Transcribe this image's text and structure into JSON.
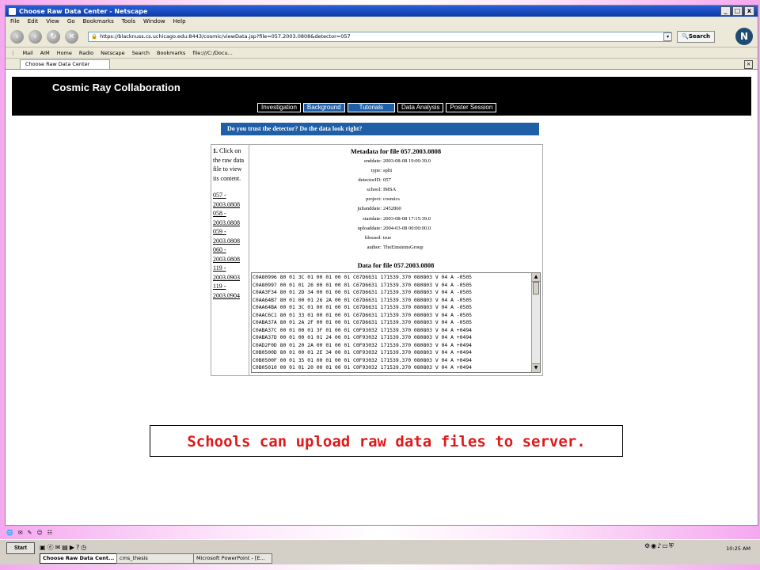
{
  "window": {
    "title": "Choose Raw Data Center - Netscape",
    "controls": [
      "_",
      "□",
      "x"
    ]
  },
  "menu": [
    "File",
    "Edit",
    "View",
    "Go",
    "Bookmarks",
    "Tools",
    "Window",
    "Help"
  ],
  "nav": {
    "url": "https://blacknuss.cs.uchicago.edu:8443/cosmic/viewData.jsp?file=057.2003.0808&detector=057",
    "search_label": "Search",
    "logo": "N"
  },
  "personal_bar": [
    "Mail",
    "AIM",
    "Home",
    "Radio",
    "Netscape",
    "Search",
    "Bookmarks",
    "file:///C:/Docu..."
  ],
  "tab": {
    "label": "Choose Raw Data Center"
  },
  "page": {
    "brand": "Cosmic Ray Collaboration",
    "topnav": [
      "Investigation",
      "Background",
      "Tutorials",
      "Data Analysis",
      "Poster Session"
    ],
    "question": "Do you trust the detector? Do the data look right?",
    "instruction_num": "1.",
    "instruction": "Click on the raw data file to view its content.",
    "files": [
      "057 - 2003.0808",
      "058 - 2003.0808",
      "059 - 2003.0808",
      "060 - 2003.0808",
      "119 - 2003.0903",
      "119 - 2003.0904"
    ],
    "metadata_title": "Metadata for file 057.2003.0808",
    "metadata": [
      {
        "k": "enddate:",
        "v": "2003-08-08 19:00:39.0"
      },
      {
        "k": "type:",
        "v": "split"
      },
      {
        "k": "detectorID:",
        "v": "057"
      },
      {
        "k": "school:",
        "v": "IMSA"
      },
      {
        "k": "project:",
        "v": "cosmics"
      },
      {
        "k": "julianddate:",
        "v": "2452860"
      },
      {
        "k": "startdate:",
        "v": "2003-08-08 17:15:39.0"
      },
      {
        "k": "uploaddate:",
        "v": "2004-03-08 00:00:00.0"
      },
      {
        "k": "blessed:",
        "v": "true"
      },
      {
        "k": "author:",
        "v": "TheEinsteinsGroup"
      }
    ],
    "data_title": "Data for file 057.2003.0808",
    "data_rows": [
      "C0A80996 80 01 3C 01 00 01 00 01 C67D6631 171539.370 080803 V 04 A -0505",
      "C0A80997 00 01 01 26 00 01 00 01 C67D6631 171539.370 080803 V 04 A -0505",
      "C0AA3F34 80 01 2D 34 00 01 00 01 C67D6631 171539.370 080803 V 04 A -0505",
      "C0AA64B7 80 01 00 01 26 2A 00 01 C67D6631 171539.370 080803 V 04 A -0505",
      "C0AA64BA 00 01 3C 01 00 01 00 01 C67D6631 171539.370 080803 V 04 A -0505",
      "C0AAC6C1 80 01 33 01 00 01 00 01 C67D6631 171539.370 080803 V 04 A -0505",
      "C0ABA37A 80 01 2A 2F 00 01 00 01 C67D6631 171539.370 080803 V 04 A -0505",
      "C0ABA37C 00 01 00 01 3F 01 00 01 C0F93032 171539.370 080803 V 04 A +0494",
      "C0ABA37D 00 01 00 01 01 24 00 01 C0F93032 171539.370 080803 V 04 A +0494",
      "C0AD2F0D 80 01 20 2A 00 01 00 01 C0F93032 171539.370 080803 V 04 A +0494",
      "C0B0500D 80 01 00 01 2E 34 00 01 C0F93032 171539.370 080803 V 04 A +0494",
      "C0B0500F 00 01 35 01 00 01 00 01 C0F93032 171539.370 080803 V 04 A +0494",
      "C0B05010 00 01 01 20 00 01 00 01 C0F93032 171539.370 080803 V 04 A +0494"
    ],
    "caption": "Schools can upload raw data files to server."
  },
  "taskbar": {
    "start": "Start",
    "buttons": [
      "Choose Raw Data Cent...",
      "cms_thesis",
      "Microsoft PowerPoint - [E..."
    ],
    "clock": "10:25 AM"
  },
  "colors": {
    "accent_blue": "#1f5fa8",
    "caption_red": "#e01818",
    "banner_black": "#000000"
  }
}
